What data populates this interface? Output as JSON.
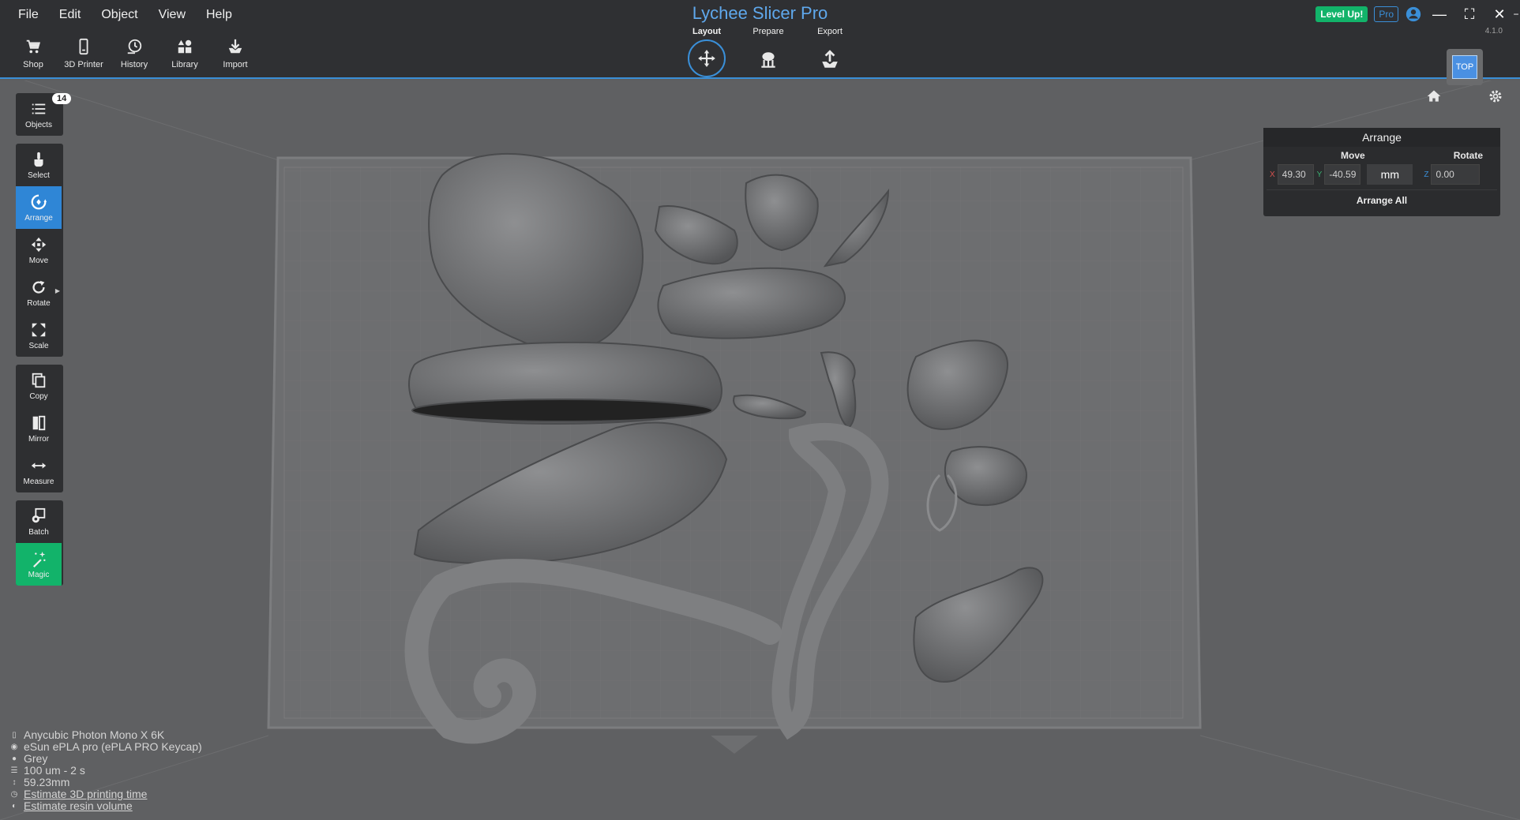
{
  "app": {
    "title": "Lychee Slicer Pro",
    "version": "4.1.0"
  },
  "menu": [
    "File",
    "Edit",
    "Object",
    "View",
    "Help"
  ],
  "toolbar": [
    {
      "label": "Shop",
      "icon": "cart-icon"
    },
    {
      "label": "3D Printer",
      "icon": "printer-icon"
    },
    {
      "label": "History",
      "icon": "history-icon"
    },
    {
      "label": "Library",
      "icon": "library-icon"
    },
    {
      "label": "Import",
      "icon": "import-icon"
    }
  ],
  "modes": [
    {
      "label": "Layout",
      "icon": "move-icon",
      "active": true
    },
    {
      "label": "Prepare",
      "icon": "supports-icon",
      "active": false
    },
    {
      "label": "Export",
      "icon": "export-icon",
      "active": false
    }
  ],
  "account": {
    "level_up": "Level Up!",
    "pro": "Pro"
  },
  "view": {
    "top_label": "TOP"
  },
  "sidebar": {
    "objects_label": "Objects",
    "objects_count": "14",
    "tools": [
      {
        "label": "Select",
        "icon": "pointer-icon"
      },
      {
        "label": "Arrange",
        "icon": "arrange-icon",
        "active": true
      },
      {
        "label": "Move",
        "icon": "move-icon"
      },
      {
        "label": "Rotate",
        "icon": "rotate-icon"
      },
      {
        "label": "Scale",
        "icon": "scale-icon"
      },
      {
        "label": "Copy",
        "icon": "copy-icon"
      },
      {
        "label": "Mirror",
        "icon": "mirror-icon"
      },
      {
        "label": "Measure",
        "icon": "measure-icon"
      },
      {
        "label": "Batch",
        "icon": "batch-icon"
      },
      {
        "label": "Magic",
        "icon": "magic-icon"
      }
    ]
  },
  "arrange_panel": {
    "title": "Arrange",
    "move_header": "Move",
    "rotate_header": "Rotate",
    "x_label": "X",
    "x_value": "49.30",
    "y_label": "Y",
    "y_value": "-40.59",
    "unit": "mm",
    "z_label": "Z",
    "z_value": "0.00",
    "arrange_all": "Arrange All"
  },
  "info": {
    "printer": "Anycubic Photon Mono X 6K",
    "resin": "eSun ePLA pro (ePLA PRO Keycap)",
    "color": "Grey",
    "layer": "100 um - 2 s",
    "height": "59.23mm",
    "estimate_time": "Estimate 3D printing time",
    "estimate_volume": "Estimate resin volume"
  },
  "colors": {
    "accent": "#3a8fd8",
    "magic": "#12b36a",
    "topbar": "#2f3033",
    "viewport": "#5f6062"
  }
}
